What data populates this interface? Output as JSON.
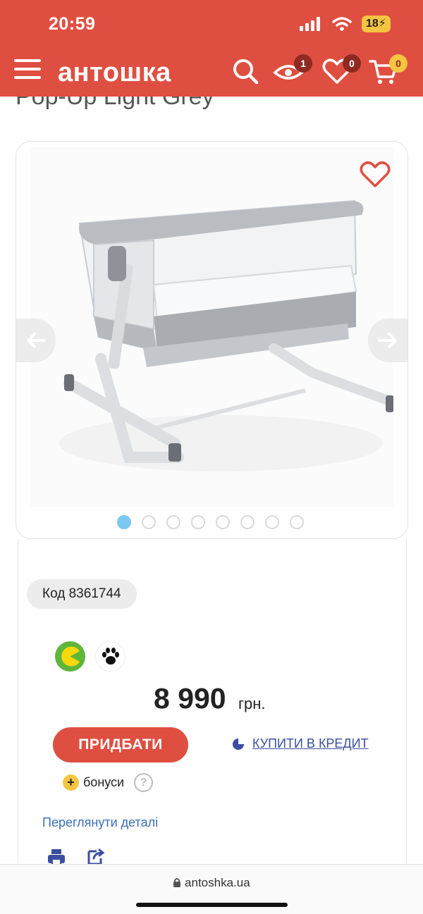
{
  "status_bar": {
    "time": "20:59",
    "battery": "18"
  },
  "header": {
    "logo_text": "антошка",
    "menu_icon": "hamburger-icon",
    "search_icon": "search-icon",
    "viewed_count": "1",
    "wishlist_count": "0",
    "cart_count": "0",
    "colors": {
      "brand": "#df4f41",
      "badge": "#8e2a21",
      "cart_badge": "#f5c542"
    }
  },
  "product": {
    "title": "Pop-Up Light Grey",
    "code_label": "Код 8361744",
    "price": "8 990",
    "currency": "грн.",
    "gallery": {
      "total_images": 8,
      "active_index": 0
    }
  },
  "actions": {
    "buy_label": "ПРИДБАТИ",
    "credit_label": "КУПИТИ В КРЕДИТ",
    "bonus_label": "бонуси",
    "help_label": "?",
    "details_label": "Переглянути деталі"
  },
  "browser": {
    "url": "antoshka.ua"
  }
}
